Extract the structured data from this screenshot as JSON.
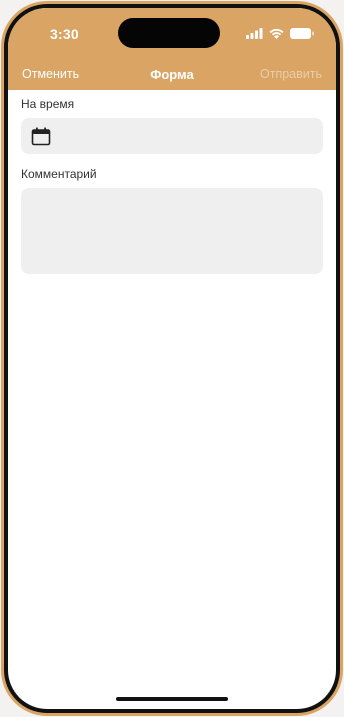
{
  "status_bar": {
    "time": "3:30",
    "icons": [
      "signal-icon",
      "wifi-icon",
      "battery-icon"
    ]
  },
  "nav": {
    "cancel_label": "Отменить",
    "title": "Форма",
    "submit_label": "Отправить"
  },
  "form": {
    "date_label": "На время",
    "date_value": "",
    "comment_label": "Комментарий",
    "comment_value": ""
  },
  "colors": {
    "accent": "#d9a464",
    "field_background": "#efefef"
  }
}
